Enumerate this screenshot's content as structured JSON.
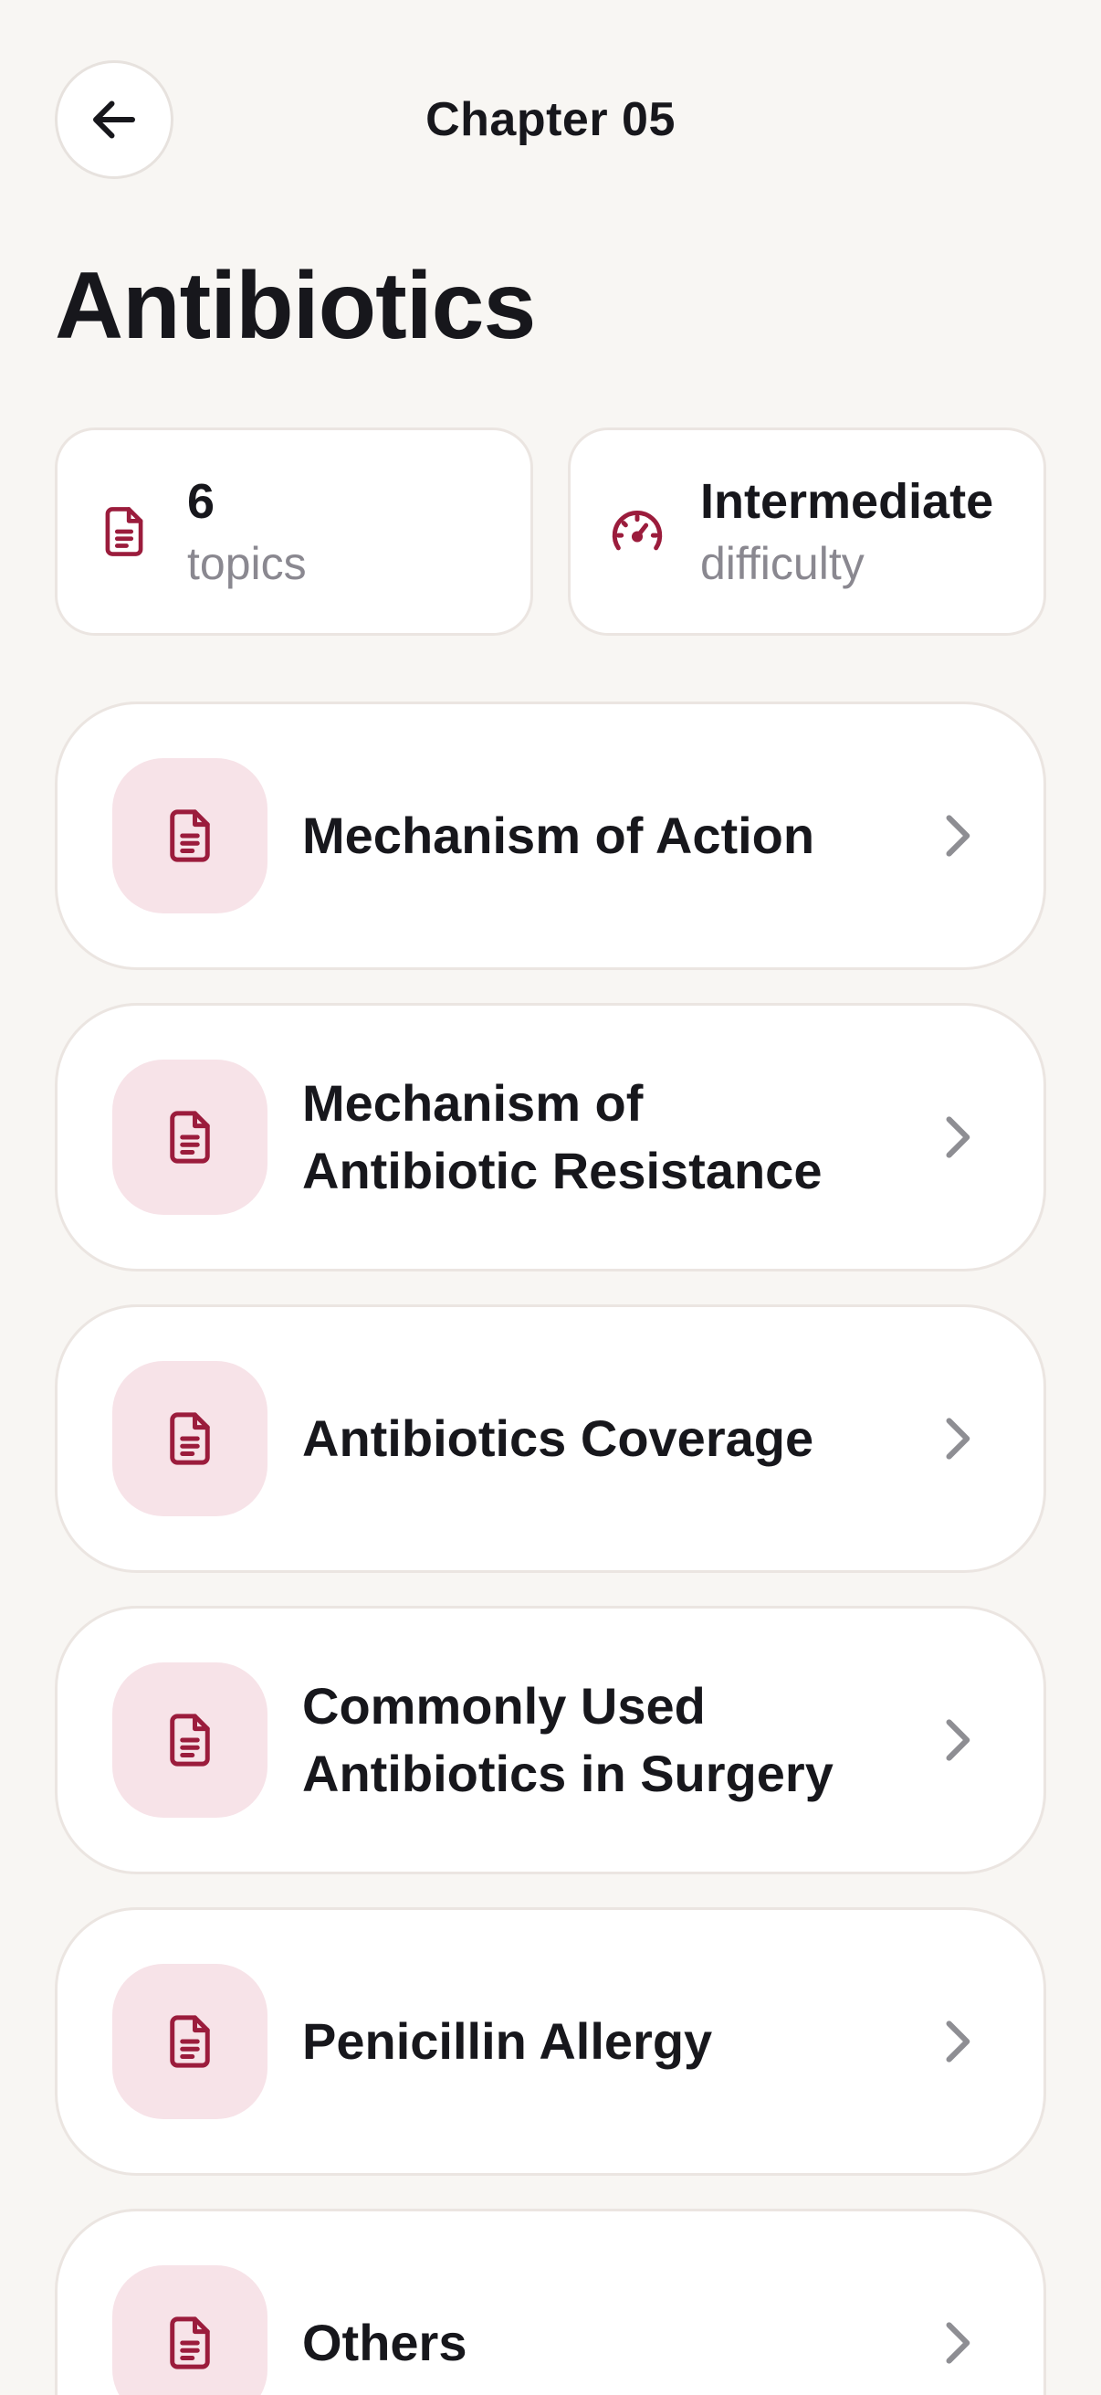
{
  "header": {
    "title": "Chapter 05",
    "back_icon": "arrow-left-icon"
  },
  "page_title": "Antibiotics",
  "stats": {
    "topics_value": "6",
    "topics_label": "topics",
    "topics_icon": "document-icon",
    "difficulty_value": "Intermediate",
    "difficulty_label": "difficulty",
    "difficulty_icon": "gauge-icon"
  },
  "topics": [
    {
      "label": "Mechanism of Action",
      "icon": "document-icon"
    },
    {
      "label": "Mechanism of Antibiotic Resistance",
      "icon": "document-icon"
    },
    {
      "label": "Antibiotics Coverage",
      "icon": "document-icon"
    },
    {
      "label": "Commonly Used Antibiotics in Surgery",
      "icon": "document-icon"
    },
    {
      "label": "Penicillin Allergy",
      "icon": "document-icon"
    },
    {
      "label": "Others",
      "icon": "document-icon"
    }
  ],
  "colors": {
    "accent": "#9b1c3c",
    "icon_tile": "#f7e3e8",
    "background": "#f8f6f3",
    "chevron": "#8e8e93"
  }
}
